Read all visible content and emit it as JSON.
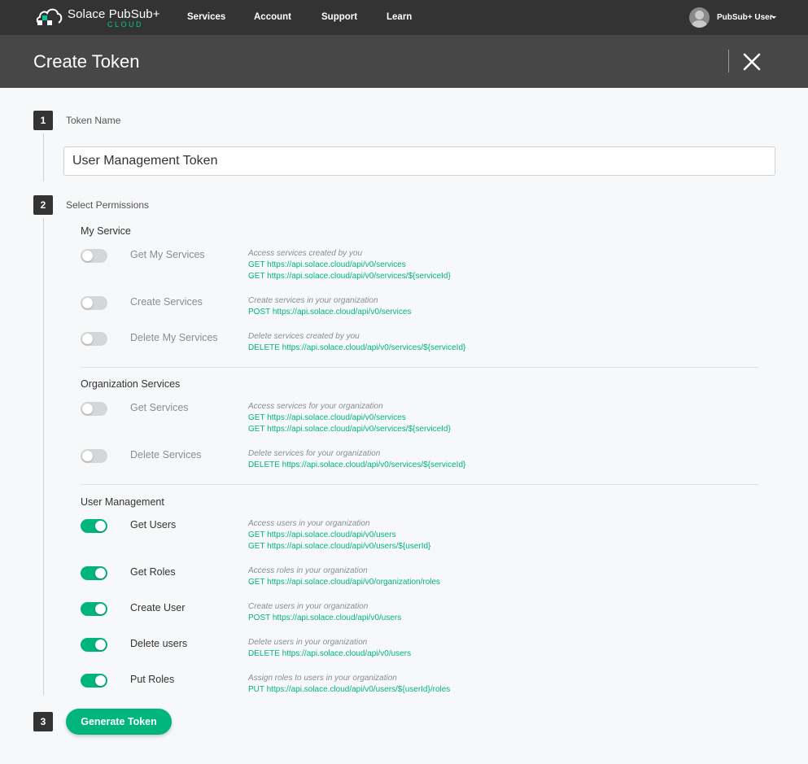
{
  "nav": {
    "brand": "Solace PubSub+",
    "brand_sub": "CLOUD",
    "links": [
      "Services",
      "Account",
      "Support",
      "Learn"
    ],
    "user": "PubSub+ User"
  },
  "page": {
    "title": "Create Token"
  },
  "steps": {
    "s1": {
      "num": "1",
      "label": "Token Name"
    },
    "s2": {
      "num": "2",
      "label": "Select Permissions"
    },
    "s3": {
      "num": "3",
      "button": "Generate Token"
    }
  },
  "token_name": {
    "value": "User Management Token"
  },
  "sections": {
    "my_service": {
      "title": "My Service",
      "items": [
        {
          "name": "Get My Services",
          "enabled": false,
          "description": "Access services created by you",
          "endpoints": [
            "GET https://api.solace.cloud/api/v0/services",
            "GET https://api.solace.cloud/api/v0/services/${serviceId}"
          ]
        },
        {
          "name": "Create Services",
          "enabled": false,
          "description": "Create services in your organization",
          "endpoints": [
            "POST https://api.solace.cloud/api/v0/services"
          ]
        },
        {
          "name": "Delete My Services",
          "enabled": false,
          "description": "Delete services created by you",
          "endpoints": [
            "DELETE https://api.solace.cloud/api/v0/services/${serviceId}"
          ]
        }
      ]
    },
    "org_services": {
      "title": "Organization Services",
      "items": [
        {
          "name": "Get Services",
          "enabled": false,
          "description": "Access services for your organization",
          "endpoints": [
            "GET https://api.solace.cloud/api/v0/services",
            "GET https://api.solace.cloud/api/v0/services/${serviceId}"
          ]
        },
        {
          "name": "Delete Services",
          "enabled": false,
          "description": "Delete services for your organization",
          "endpoints": [
            "DELETE https://api.solace.cloud/api/v0/services/${serviceId}"
          ]
        }
      ]
    },
    "user_mgmt": {
      "title": "User Management",
      "items": [
        {
          "name": "Get Users",
          "enabled": true,
          "description": "Access users in your organization",
          "endpoints": [
            "GET https://api.solace.cloud/api/v0/users",
            "GET https://api.solace.cloud/api/v0/users/${userId}"
          ]
        },
        {
          "name": "Get Roles",
          "enabled": true,
          "description": "Access roles in your organization",
          "endpoints": [
            "GET https://api.solace.cloud/api/v0/organization/roles"
          ]
        },
        {
          "name": "Create User",
          "enabled": true,
          "description": "Create users in your organization",
          "endpoints": [
            "POST https://api.solace.cloud/api/v0/users"
          ]
        },
        {
          "name": "Delete users",
          "enabled": true,
          "description": "Delete users in your organization",
          "endpoints": [
            "DELETE https://api.solace.cloud/api/v0/users"
          ]
        },
        {
          "name": "Put Roles",
          "enabled": true,
          "description": "Assign roles to users in your organization",
          "endpoints": [
            "PUT https://api.solace.cloud/api/v0/users/${userId}/roles"
          ]
        }
      ]
    }
  },
  "icons": {
    "logo": "solace-cloud-logo-icon",
    "avatar": "user-avatar-icon",
    "caret": "caret-down-icon",
    "close": "close-icon"
  },
  "colors": {
    "accent": "#00b57c",
    "nav_bg": "#333333",
    "title_bg": "#474747"
  }
}
